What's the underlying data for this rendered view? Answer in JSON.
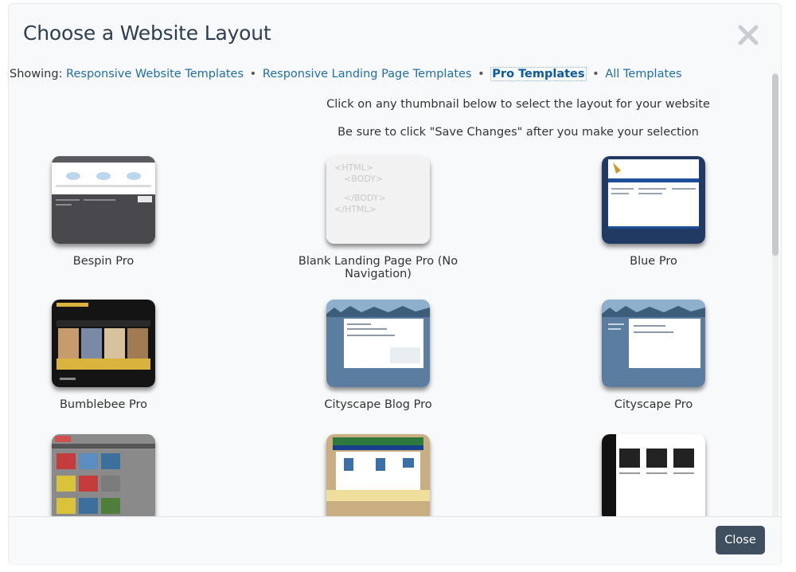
{
  "modal": {
    "title": "Choose a Website Layout",
    "close_label": "Close"
  },
  "filter": {
    "prefix": "Showing:",
    "links": [
      {
        "label": "Responsive Website Templates"
      },
      {
        "label": "Responsive Landing Page Templates"
      },
      {
        "label": "Pro Templates",
        "active": true
      },
      {
        "label": "All Templates"
      }
    ],
    "separator": "•"
  },
  "instructions": {
    "line1": "Click on any thumbnail below to select the layout for your website",
    "line2": "Be sure to click \"Save Changes\" after you make your selection"
  },
  "blank_thumb_text": [
    "<HTML>",
    "<BODY>",
    "</BODY>",
    "</HTML>"
  ],
  "templates": [
    {
      "name": "Bespin Pro"
    },
    {
      "name": "Blank Landing Page Pro (No Navigation)"
    },
    {
      "name": "Blue Pro"
    },
    {
      "name": "Bumblebee Pro"
    },
    {
      "name": "Cityscape Blog Pro"
    },
    {
      "name": "Cityscape Pro"
    },
    {
      "name": ""
    },
    {
      "name": ""
    },
    {
      "name": ""
    }
  ],
  "colors": {
    "link": "#1f6fa6",
    "button_bg": "#3f4f60",
    "title": "#2f3e4e"
  }
}
